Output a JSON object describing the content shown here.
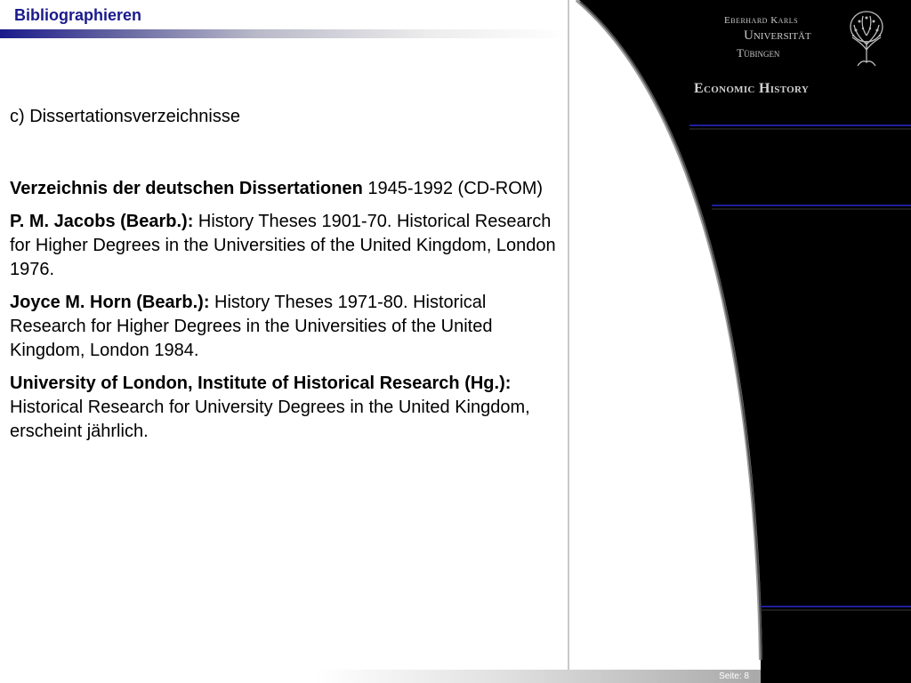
{
  "header": {
    "title": "Bibliographieren",
    "accent_color": "#1a1a8c"
  },
  "university": {
    "line1": "Eberhard Karls",
    "line2": "Universität",
    "line3": "Tübingen",
    "logo_icon": "tree-icon"
  },
  "department": "Economic History",
  "content": {
    "section_heading": "c) Dissertationsverzeichnisse",
    "entries": [
      {
        "bold": "Verzeichnis der deutschen Dissertationen",
        "text": " 1945-1992 (CD-ROM)"
      },
      {
        "bold": "P. M. Jacobs (Bearb.):",
        "text": " History Theses 1901-70. Historical Research for Higher Degrees in the Universities of the United Kingdom, London 1976."
      },
      {
        "bold": "Joyce M. Horn (Bearb.):",
        "text": " History Theses 1971-80. Historical Research for Higher Degrees in the Universities of the United Kingdom, London 1984."
      },
      {
        "bold": "University of London, Institute of Historical Research (Hg.):",
        "text": " Historical Research for University Degrees in the United Kingdom, erscheint jährlich."
      }
    ]
  },
  "footer": {
    "page_label": "Seite: 8"
  },
  "colors": {
    "panel_background": "#000000",
    "rule_color": "#1e1e9c"
  }
}
